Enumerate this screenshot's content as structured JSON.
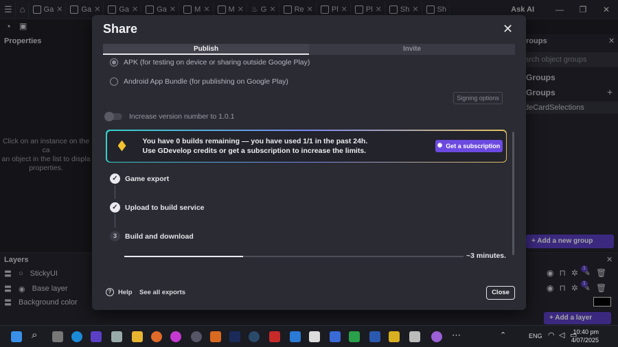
{
  "tabs": [
    "Ga",
    "Ga",
    "Ga",
    "Ga",
    "M",
    "M",
    "G",
    "Re",
    "Pl",
    "Pl",
    "Sh",
    "Sh"
  ],
  "ask_ai": "Ask AI",
  "properties": {
    "title": "Properties",
    "hint_lines": [
      "Click on an instance on the ca",
      "an object in the list to displa",
      "properties."
    ]
  },
  "right_panel": {
    "search_placeholder": "arch object groups",
    "groups_header": "roups",
    "groups_label": "Groups",
    "groups_section": "Groups",
    "group_item": "deCardSelections",
    "add_group": "Add a new group"
  },
  "layers": {
    "title": "Layers",
    "rows": [
      "StickyUI",
      "Base layer",
      "Background color"
    ],
    "add_layer": "Add a layer",
    "badge": "1"
  },
  "modal": {
    "title": "Share",
    "tabs": [
      {
        "label": "Publish",
        "active": true
      },
      {
        "label": "Invite",
        "active": false
      }
    ],
    "options": [
      {
        "label": "APK (for testing on device or sharing outside Google Play)",
        "selected": true
      },
      {
        "label": "Android App Bundle (for publishing on Google Play)",
        "selected": false
      }
    ],
    "signing_options": "Signing options",
    "version_toggle": "Increase version number to 1.0.1",
    "banner": {
      "line1_pre": "You have ",
      "line1_count": "0",
      "line1_post": " builds remaining — you have used 1/1 in the past 24h.",
      "line2": "Use GDevelop credits or get a subscription to increase the limits.",
      "button": "Get a subscription"
    },
    "steps": [
      {
        "label": "Game export",
        "done": true
      },
      {
        "label": "Upload to build service",
        "done": true
      },
      {
        "label": "Build and download",
        "done": false,
        "number": "3"
      }
    ],
    "progress": {
      "fraction": 0.35,
      "label": "~3 minutes."
    },
    "footer": {
      "help": "Help",
      "see_all": "See all exports",
      "close": "Close"
    }
  },
  "taskbar": {
    "lang": "ENG",
    "time": "10:40 pm",
    "date": "4/07/2025"
  },
  "colors": {
    "accent": "#6c4ae0",
    "modal_bg": "#2b2b33",
    "background": "#1f1f26"
  }
}
